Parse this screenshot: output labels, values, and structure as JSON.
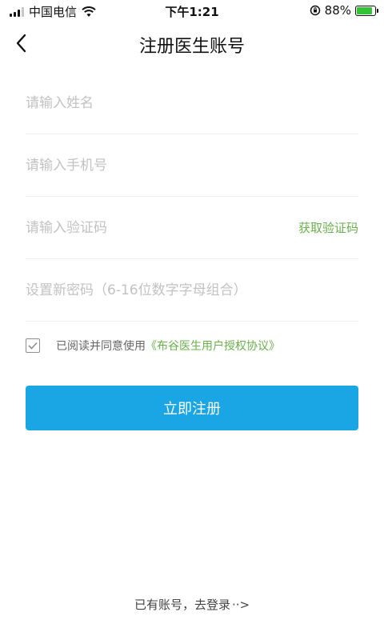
{
  "status_bar": {
    "carrier": "中国电信",
    "time": "下午1:21",
    "battery_percent": "88%",
    "battery_level": 0.88
  },
  "nav": {
    "title": "注册医生账号"
  },
  "form": {
    "name_placeholder": "请输入姓名",
    "phone_placeholder": "请输入手机号",
    "code_placeholder": "请输入验证码",
    "get_code_label": "获取验证码",
    "password_placeholder": "设置新密码（6-16位数字字母组合）"
  },
  "agreement": {
    "checked": true,
    "text": "已阅读并同意使用",
    "link": "《布谷医生用户授权协议》"
  },
  "submit_label": "立即注册",
  "login": {
    "text": "已有账号，去登录",
    "arrow": "··>"
  },
  "colors": {
    "primary": "#1aa6e4",
    "link": "#6ab04c",
    "battery": "#36c236"
  }
}
